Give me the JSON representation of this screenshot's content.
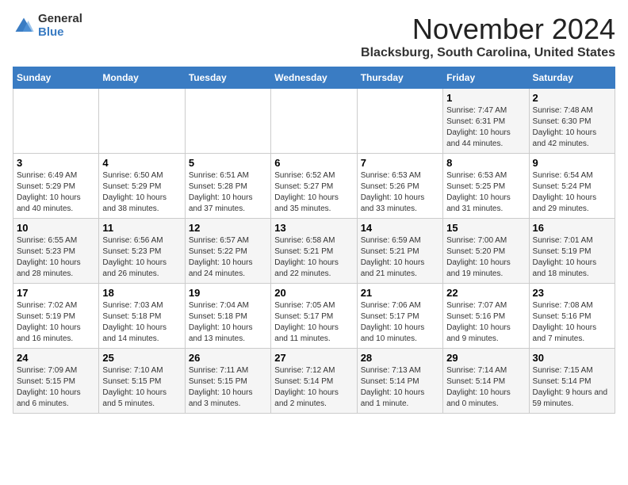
{
  "logo": {
    "general": "General",
    "blue": "Blue"
  },
  "title": "November 2024",
  "location": "Blacksburg, South Carolina, United States",
  "days_of_week": [
    "Sunday",
    "Monday",
    "Tuesday",
    "Wednesday",
    "Thursday",
    "Friday",
    "Saturday"
  ],
  "weeks": [
    [
      {
        "day": "",
        "info": ""
      },
      {
        "day": "",
        "info": ""
      },
      {
        "day": "",
        "info": ""
      },
      {
        "day": "",
        "info": ""
      },
      {
        "day": "",
        "info": ""
      },
      {
        "day": "1",
        "info": "Sunrise: 7:47 AM\nSunset: 6:31 PM\nDaylight: 10 hours and 44 minutes."
      },
      {
        "day": "2",
        "info": "Sunrise: 7:48 AM\nSunset: 6:30 PM\nDaylight: 10 hours and 42 minutes."
      }
    ],
    [
      {
        "day": "3",
        "info": "Sunrise: 6:49 AM\nSunset: 5:29 PM\nDaylight: 10 hours and 40 minutes."
      },
      {
        "day": "4",
        "info": "Sunrise: 6:50 AM\nSunset: 5:29 PM\nDaylight: 10 hours and 38 minutes."
      },
      {
        "day": "5",
        "info": "Sunrise: 6:51 AM\nSunset: 5:28 PM\nDaylight: 10 hours and 37 minutes."
      },
      {
        "day": "6",
        "info": "Sunrise: 6:52 AM\nSunset: 5:27 PM\nDaylight: 10 hours and 35 minutes."
      },
      {
        "day": "7",
        "info": "Sunrise: 6:53 AM\nSunset: 5:26 PM\nDaylight: 10 hours and 33 minutes."
      },
      {
        "day": "8",
        "info": "Sunrise: 6:53 AM\nSunset: 5:25 PM\nDaylight: 10 hours and 31 minutes."
      },
      {
        "day": "9",
        "info": "Sunrise: 6:54 AM\nSunset: 5:24 PM\nDaylight: 10 hours and 29 minutes."
      }
    ],
    [
      {
        "day": "10",
        "info": "Sunrise: 6:55 AM\nSunset: 5:23 PM\nDaylight: 10 hours and 28 minutes."
      },
      {
        "day": "11",
        "info": "Sunrise: 6:56 AM\nSunset: 5:23 PM\nDaylight: 10 hours and 26 minutes."
      },
      {
        "day": "12",
        "info": "Sunrise: 6:57 AM\nSunset: 5:22 PM\nDaylight: 10 hours and 24 minutes."
      },
      {
        "day": "13",
        "info": "Sunrise: 6:58 AM\nSunset: 5:21 PM\nDaylight: 10 hours and 22 minutes."
      },
      {
        "day": "14",
        "info": "Sunrise: 6:59 AM\nSunset: 5:21 PM\nDaylight: 10 hours and 21 minutes."
      },
      {
        "day": "15",
        "info": "Sunrise: 7:00 AM\nSunset: 5:20 PM\nDaylight: 10 hours and 19 minutes."
      },
      {
        "day": "16",
        "info": "Sunrise: 7:01 AM\nSunset: 5:19 PM\nDaylight: 10 hours and 18 minutes."
      }
    ],
    [
      {
        "day": "17",
        "info": "Sunrise: 7:02 AM\nSunset: 5:19 PM\nDaylight: 10 hours and 16 minutes."
      },
      {
        "day": "18",
        "info": "Sunrise: 7:03 AM\nSunset: 5:18 PM\nDaylight: 10 hours and 14 minutes."
      },
      {
        "day": "19",
        "info": "Sunrise: 7:04 AM\nSunset: 5:18 PM\nDaylight: 10 hours and 13 minutes."
      },
      {
        "day": "20",
        "info": "Sunrise: 7:05 AM\nSunset: 5:17 PM\nDaylight: 10 hours and 11 minutes."
      },
      {
        "day": "21",
        "info": "Sunrise: 7:06 AM\nSunset: 5:17 PM\nDaylight: 10 hours and 10 minutes."
      },
      {
        "day": "22",
        "info": "Sunrise: 7:07 AM\nSunset: 5:16 PM\nDaylight: 10 hours and 9 minutes."
      },
      {
        "day": "23",
        "info": "Sunrise: 7:08 AM\nSunset: 5:16 PM\nDaylight: 10 hours and 7 minutes."
      }
    ],
    [
      {
        "day": "24",
        "info": "Sunrise: 7:09 AM\nSunset: 5:15 PM\nDaylight: 10 hours and 6 minutes."
      },
      {
        "day": "25",
        "info": "Sunrise: 7:10 AM\nSunset: 5:15 PM\nDaylight: 10 hours and 5 minutes."
      },
      {
        "day": "26",
        "info": "Sunrise: 7:11 AM\nSunset: 5:15 PM\nDaylight: 10 hours and 3 minutes."
      },
      {
        "day": "27",
        "info": "Sunrise: 7:12 AM\nSunset: 5:14 PM\nDaylight: 10 hours and 2 minutes."
      },
      {
        "day": "28",
        "info": "Sunrise: 7:13 AM\nSunset: 5:14 PM\nDaylight: 10 hours and 1 minute."
      },
      {
        "day": "29",
        "info": "Sunrise: 7:14 AM\nSunset: 5:14 PM\nDaylight: 10 hours and 0 minutes."
      },
      {
        "day": "30",
        "info": "Sunrise: 7:15 AM\nSunset: 5:14 PM\nDaylight: 9 hours and 59 minutes."
      }
    ]
  ]
}
